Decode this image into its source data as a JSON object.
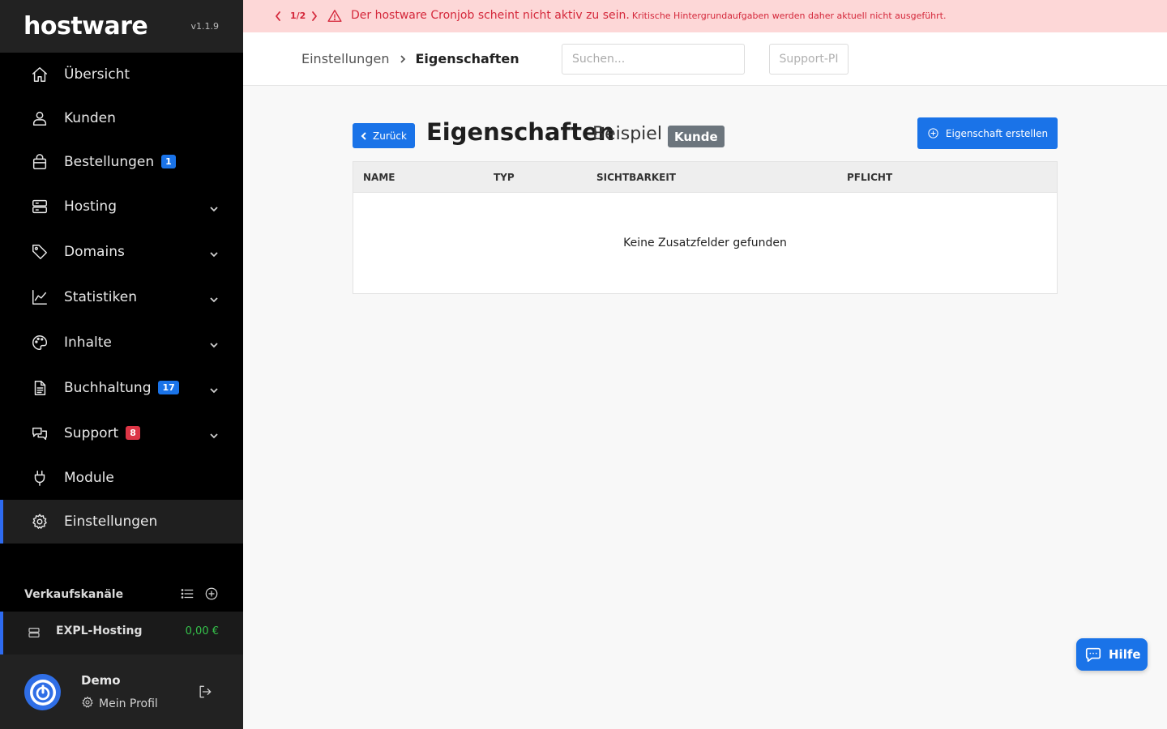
{
  "app": {
    "logo": "hostware",
    "version": "v1.1.9"
  },
  "alert": {
    "pager": "1/2",
    "message": "Der hostware Cronjob scheint nicht aktiv zu sein.",
    "detail": "Kritische Hintergrundaufgaben werden daher aktuell nicht ausgeführt.",
    "color": "#d4273a",
    "background": "#fdd7d7"
  },
  "sidebar": {
    "items": [
      {
        "label": "Übersicht",
        "icon": "home-icon"
      },
      {
        "label": "Kunden",
        "icon": "user-icon"
      },
      {
        "label": "Bestellungen",
        "icon": "shopping-bag-icon",
        "badge": "1",
        "badge_color": "#1a73e8"
      },
      {
        "label": "Hosting",
        "icon": "server-icon",
        "expandable": true
      },
      {
        "label": "Domains",
        "icon": "tag-icon",
        "expandable": true
      },
      {
        "label": "Statistiken",
        "icon": "chart-line-icon",
        "expandable": true
      },
      {
        "label": "Inhalte",
        "icon": "palette-icon",
        "expandable": true
      },
      {
        "label": "Buchhaltung",
        "icon": "document-icon",
        "badge": "17",
        "badge_color": "#1a73e8",
        "expandable": true
      },
      {
        "label": "Support",
        "icon": "chat-icon",
        "badge": "8",
        "badge_color": "#dc3545",
        "expandable": true
      },
      {
        "label": "Module",
        "icon": "plug-icon"
      },
      {
        "label": "Einstellungen",
        "icon": "gear-icon",
        "active": true
      }
    ],
    "sales_channels": {
      "title": "Verkaufskanäle",
      "channel": {
        "name": "EXPL-Hosting",
        "amount": "0,00 €",
        "amount_color": "#35c24b"
      }
    },
    "profile": {
      "name": "Demo",
      "link": "Mein Profil"
    }
  },
  "topbar": {
    "breadcrumb": {
      "parent": "Einstellungen",
      "current": "Eigenschaften"
    },
    "search": {
      "placeholder": "Suchen...",
      "value": ""
    },
    "support_pi": "Support-PI"
  },
  "page": {
    "back_label": "Zurück",
    "title": "Eigenschaften",
    "subtitle": "Beispiel",
    "badge": "Kunde",
    "create_label": "Eigenschaft erstellen"
  },
  "table": {
    "columns": [
      "NAME",
      "TYP",
      "SICHTBARKEIT",
      "PFLICHT"
    ],
    "rows": [],
    "empty_message": "Keine Zusatzfelder gefunden"
  },
  "help": {
    "label": "Hilfe"
  },
  "colors": {
    "accent": "#1a73e8",
    "sidebar_bg": "#000000",
    "active_border": "#2e6bf0"
  }
}
